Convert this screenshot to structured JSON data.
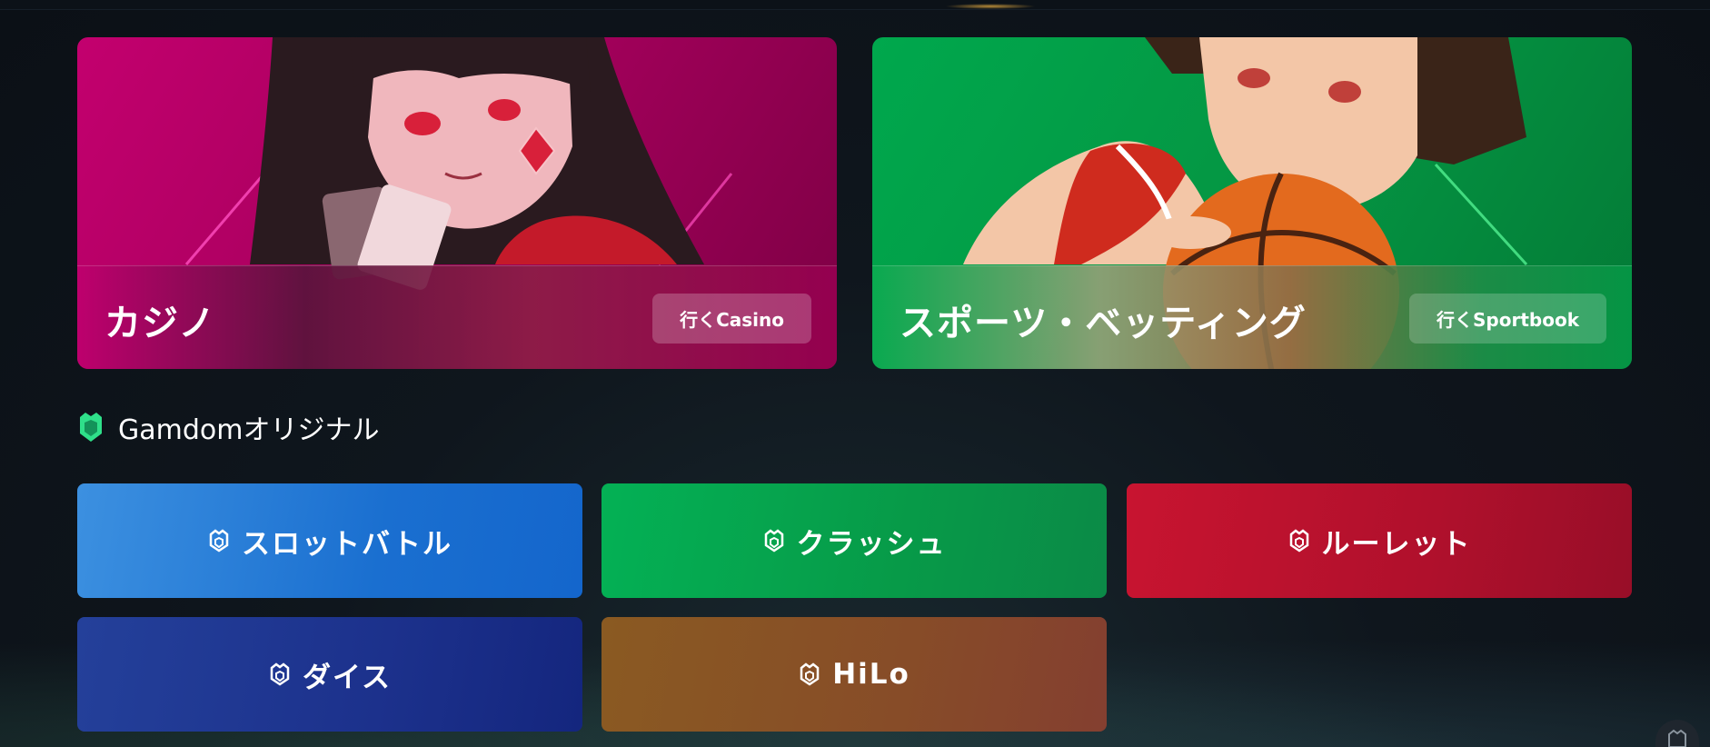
{
  "hero_cards": {
    "casino": {
      "title": "カジノ",
      "button_label": "行くCasino"
    },
    "sports": {
      "title": "スポーツ・ベッティング",
      "button_label": "行くSportbook"
    }
  },
  "originals_section": {
    "title": "Gamdomオリジナル",
    "games": [
      {
        "label": "スロットバトル",
        "icon": "gamdom-shield-icon",
        "color": "#1a6fd0"
      },
      {
        "label": "クラッシュ",
        "icon": "gamdom-shield-icon",
        "color": "#079a48"
      },
      {
        "label": "ルーレット",
        "icon": "gamdom-shield-icon",
        "color": "#b0102c"
      },
      {
        "label": "ダイス",
        "icon": "gamdom-shield-icon",
        "color": "#1c318c"
      },
      {
        "label": "HiLo",
        "icon": "gamdom-shield-icon",
        "color": "#874c28"
      }
    ]
  },
  "colors": {
    "background": "#0b1016",
    "casino_accent": "#c3006e",
    "sports_accent": "#00a84d",
    "brand_green": "#2fe08a"
  }
}
